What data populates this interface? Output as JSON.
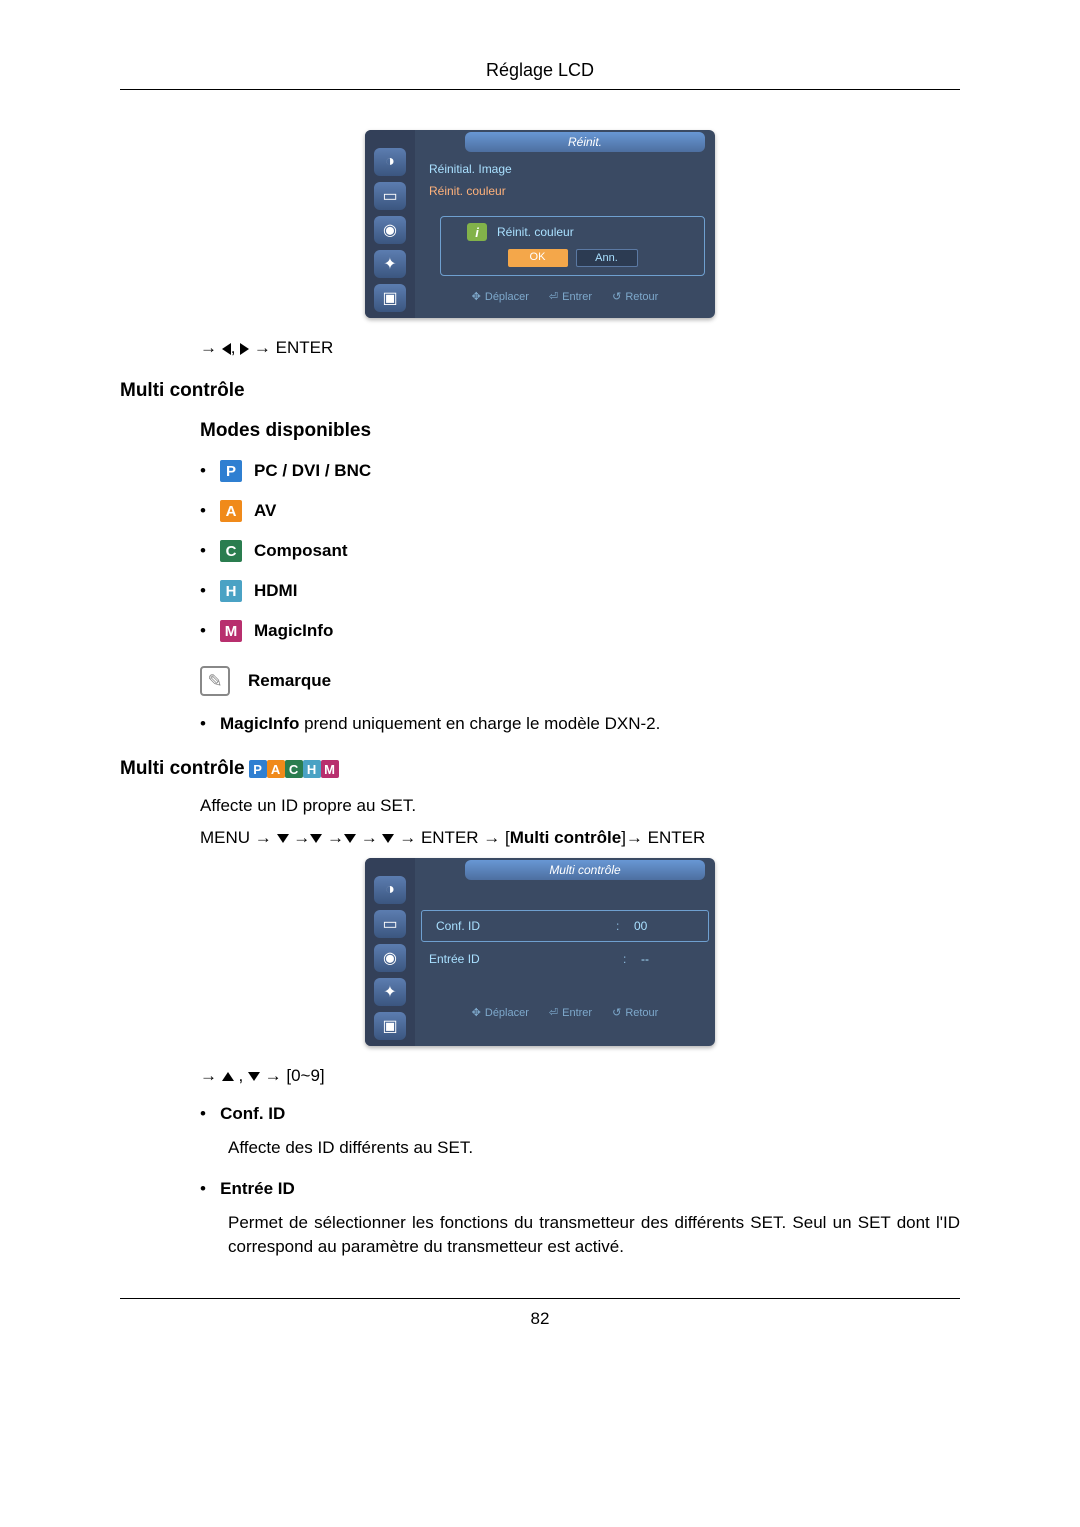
{
  "header": {
    "title": "Réglage LCD"
  },
  "osd1": {
    "tab": "Réinit.",
    "row1": "Réinitial. Image",
    "row2": "Réinit. couleur",
    "dialog_label": "Réinit. couleur",
    "ok": "OK",
    "ann": "Ann.",
    "foot_move": "Déplacer",
    "foot_enter": "Entrer",
    "foot_return": "Retour"
  },
  "nav1_enter": "ENTER",
  "h2_multi": "Multi contrôle",
  "h3_modes": "Modes disponibles",
  "modes": {
    "pc": "PC / DVI / BNC",
    "av": "AV",
    "comp": "Composant",
    "hdmi": "HDMI",
    "mi": "MagicInfo"
  },
  "remarque": "Remarque",
  "note_line_prefix": "MagicInfo",
  "note_line_rest": " prend uniquement en charge le modèle DXN-2.",
  "h2_multi2": "Multi contrôle",
  "affecte": "Affecte un ID propre au SET.",
  "menu_word": "MENU",
  "enter_word": "ENTER",
  "bracket_label": "Multi contrôle",
  "osd2": {
    "tab": "Multi contrôle",
    "conf": "Conf. ID",
    "conf_v": "00",
    "entree": "Entrée ID",
    "entree_v": "--",
    "foot_move": "Déplacer",
    "foot_enter": "Entrer",
    "foot_return": "Retour"
  },
  "range": "[0~9]",
  "conf_label": "Conf. ID",
  "conf_desc": "Affecte des ID différents au SET.",
  "entree_label": "Entrée ID",
  "entree_desc": "Permet de sélectionner les fonctions du transmetteur des différents SET. Seul un SET dont l'ID correspond au paramètre du transmetteur est activé.",
  "page": "82"
}
